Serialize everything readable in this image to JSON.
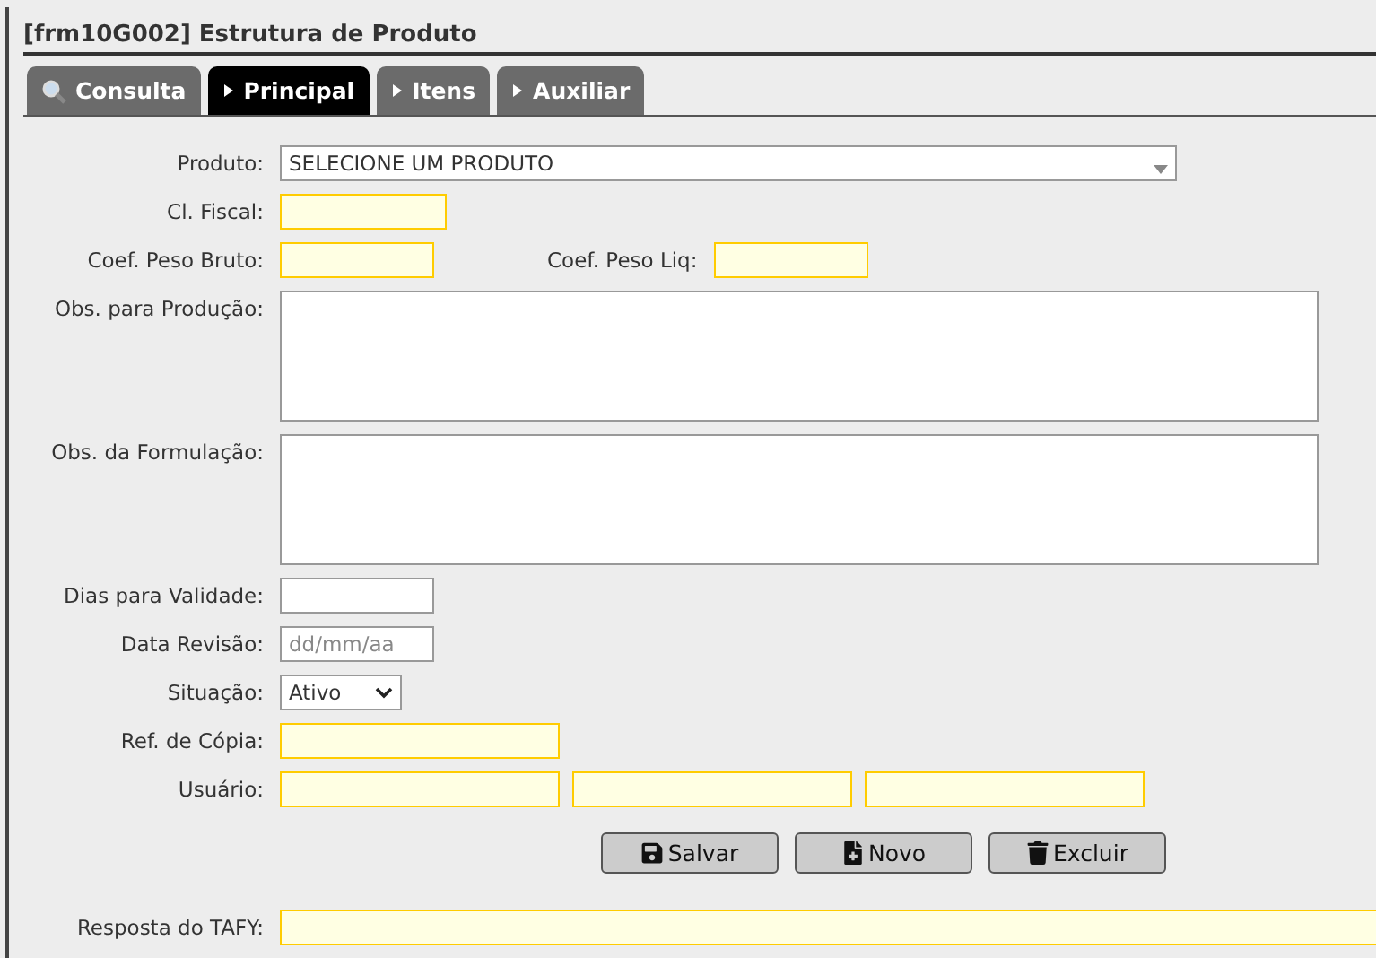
{
  "window": {
    "title": "[frm10G002] Estrutura de Produto"
  },
  "tabs": [
    {
      "label": "Consulta",
      "kind": "search",
      "selected": false
    },
    {
      "label": "Principal",
      "kind": "arrow",
      "selected": true
    },
    {
      "label": "Itens",
      "kind": "arrow",
      "selected": false
    },
    {
      "label": "Auxiliar",
      "kind": "arrow",
      "selected": false
    }
  ],
  "rows": [
    {
      "label": "Produto:",
      "fields": [
        {
          "kind": "select",
          "value": "SELECIONE UM PRODUTO",
          "highlighted": false
        }
      ]
    },
    {
      "label": "Cl. Fiscal:",
      "fields": [
        {
          "kind": "code",
          "highlighted": true
        }
      ]
    },
    {
      "label": "Coef. Peso Bruto:",
      "fields": [
        {
          "kind": "number",
          "highlighted": true
        },
        {
          "kind": "number",
          "label": "Coef. Peso Liq:",
          "highlighted": true
        }
      ]
    },
    {
      "label": "Obs. para Produção:",
      "fields": [
        {
          "kind": "memo",
          "highlighted": false
        }
      ]
    },
    {
      "label": "Obs. da Formulação:",
      "fields": [
        {
          "kind": "memo",
          "highlighted": false
        }
      ]
    },
    {
      "label": "Dias para Validade:",
      "fields": [
        {
          "kind": "number",
          "highlighted": false
        }
      ]
    },
    {
      "label": "Data Revisão:",
      "fields": [
        {
          "kind": "number",
          "placeholder": "dd/mm/aa",
          "highlighted": false
        }
      ]
    },
    {
      "label": "Situação:",
      "fields": [
        {
          "kind": "dropdown",
          "value": "Ativo",
          "highlighted": false
        }
      ]
    },
    {
      "label": "Ref. de Cópia:",
      "fields": [
        {
          "kind": "text",
          "highlighted": true
        }
      ]
    },
    {
      "label": "Usuário:",
      "fields": [
        {
          "kind": "text",
          "highlighted": true
        },
        {
          "kind": "text",
          "highlighted": true
        },
        {
          "kind": "text",
          "highlighted": true
        }
      ]
    }
  ],
  "buttons": [
    {
      "label": "Salvar",
      "kind": "save"
    },
    {
      "label": "Novo",
      "kind": "new"
    },
    {
      "label": "Excluir",
      "kind": "delete"
    }
  ],
  "response": {
    "label": "Resposta do TAFY:",
    "highlighted": true
  }
}
